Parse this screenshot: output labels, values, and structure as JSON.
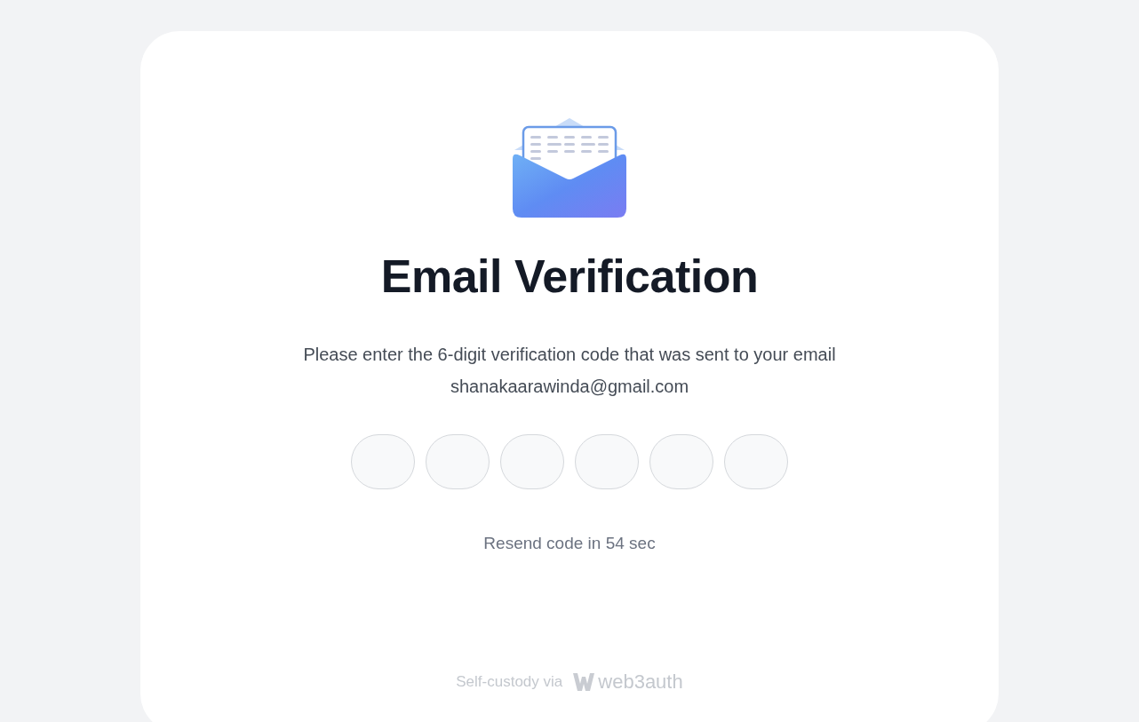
{
  "title": "Email Verification",
  "message": "Please enter the 6-digit verification code that was sent to your email",
  "email": "shanakaarawinda@gmail.com",
  "code_fields": [
    {
      "kind": "digit"
    },
    {
      "kind": "digit"
    },
    {
      "kind": "digit"
    },
    {
      "kind": "digit"
    },
    {
      "kind": "digit"
    },
    {
      "kind": "digit"
    }
  ],
  "resend": "Resend code in 54 sec",
  "footer": {
    "prefix": "Self-custody via",
    "brand": "web3auth"
  }
}
